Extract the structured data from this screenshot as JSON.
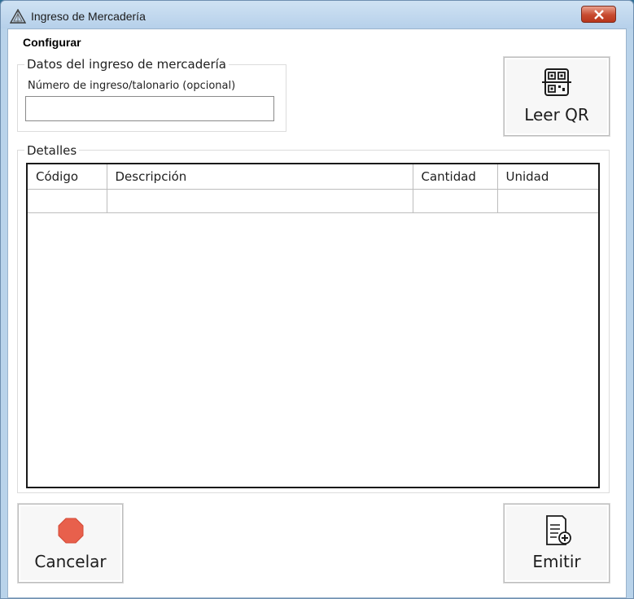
{
  "window": {
    "title": "Ingreso de Mercadería",
    "close_icon": "close-x-icon",
    "app_icon": "triangle-logo-icon"
  },
  "menu": {
    "configurar": "Configurar"
  },
  "datos": {
    "legend": "Datos del ingreso de mercadería",
    "field_label": "Número de ingreso/talonario (opcional)",
    "field_value": "",
    "field_placeholder": ""
  },
  "buttons": {
    "leer_qr": {
      "label": "Leer QR",
      "icon": "qr-scan-icon"
    },
    "cancelar": {
      "label": "Cancelar",
      "icon": "stop-octagon-icon",
      "icon_color": "#e8604c"
    },
    "emitir": {
      "label": "Emitir",
      "icon": "document-add-icon"
    }
  },
  "detalles": {
    "legend": "Detalles",
    "columns": [
      "Código",
      "Descripción",
      "Cantidad",
      "Unidad"
    ],
    "rows": [
      [
        "",
        "",
        "",
        ""
      ]
    ]
  },
  "colors": {
    "titlebar": "#b6d0ea",
    "close_button": "#c74a2f",
    "stop_icon": "#e8604c"
  }
}
